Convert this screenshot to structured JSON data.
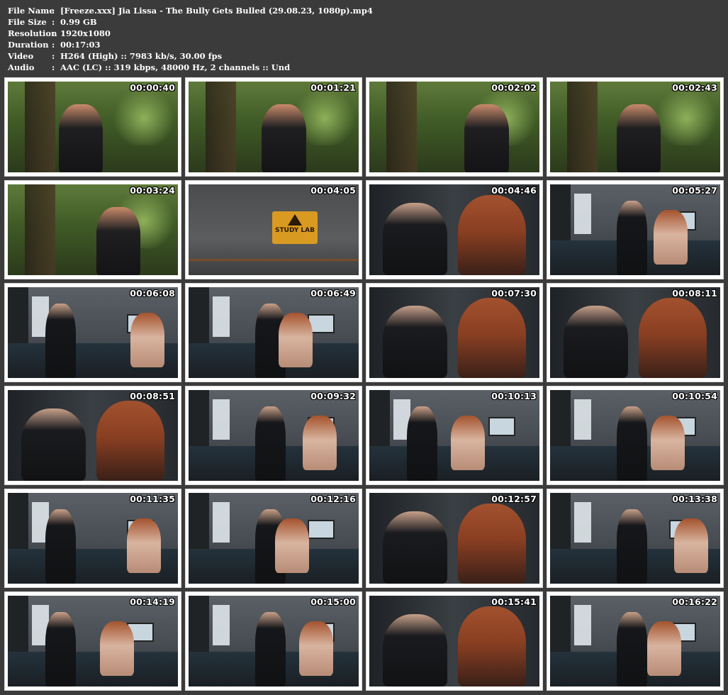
{
  "file_info": [
    {
      "label": "File Name",
      "value": "[Freeze.xxx] Jia Lissa - The Bully Gets Bulled (29.08.23, 1080p).mp4"
    },
    {
      "label": "File Size",
      "value": "0.99 GB"
    },
    {
      "label": "Resolution",
      "value": "1920x1080"
    },
    {
      "label": "Duration",
      "value": "00:17:03"
    },
    {
      "label": "Video",
      "value": "H264 (High) :: 7983 kb/s, 30.00 fps"
    },
    {
      "label": "Audio",
      "value": "AAC (LC) :: 319 kbps, 48000 Hz, 2 channels :: Und"
    }
  ],
  "separator": ":",
  "sign_text": "STUDY LAB",
  "thumbnails": [
    {
      "time": "00:00:40",
      "scene": "forest"
    },
    {
      "time": "00:01:21",
      "scene": "forest"
    },
    {
      "time": "00:02:02",
      "scene": "forest"
    },
    {
      "time": "00:02:43",
      "scene": "forest"
    },
    {
      "time": "00:03:24",
      "scene": "forest"
    },
    {
      "time": "00:04:05",
      "scene": "sign"
    },
    {
      "time": "00:04:46",
      "scene": "dark"
    },
    {
      "time": "00:05:27",
      "scene": "lab"
    },
    {
      "time": "00:06:08",
      "scene": "lab"
    },
    {
      "time": "00:06:49",
      "scene": "lab"
    },
    {
      "time": "00:07:30",
      "scene": "dark"
    },
    {
      "time": "00:08:11",
      "scene": "dark"
    },
    {
      "time": "00:08:51",
      "scene": "dark"
    },
    {
      "time": "00:09:32",
      "scene": "lab"
    },
    {
      "time": "00:10:13",
      "scene": "lab"
    },
    {
      "time": "00:10:54",
      "scene": "lab"
    },
    {
      "time": "00:11:35",
      "scene": "lab"
    },
    {
      "time": "00:12:16",
      "scene": "lab"
    },
    {
      "time": "00:12:57",
      "scene": "dark"
    },
    {
      "time": "00:13:38",
      "scene": "lab"
    },
    {
      "time": "00:14:19",
      "scene": "lab"
    },
    {
      "time": "00:15:00",
      "scene": "lab"
    },
    {
      "time": "00:15:41",
      "scene": "dark"
    },
    {
      "time": "00:16:22",
      "scene": "lab"
    }
  ],
  "colors": {
    "background": "#3b3b3b",
    "thumb_border": "#ffffff",
    "sign": "#d99a22"
  }
}
